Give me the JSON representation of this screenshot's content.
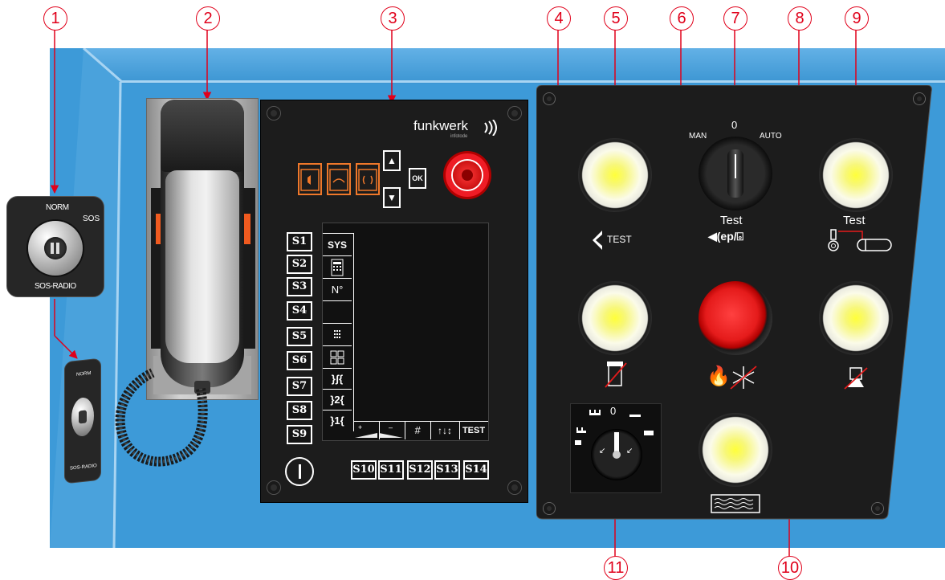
{
  "callouts": [
    "1",
    "2",
    "3",
    "4",
    "5",
    "6",
    "7",
    "8",
    "9",
    "10",
    "11"
  ],
  "sos_switch": {
    "norm": "NORM",
    "sos": "SOS",
    "radio": "SOS-RADIO"
  },
  "radio_panel": {
    "brand": "funkwerk",
    "brand_sub": "infotode",
    "ok_label": "OK",
    "s_keys_left": [
      "S1",
      "S2",
      "S3",
      "S4",
      "S5",
      "S6",
      "S7",
      "S8",
      "S9"
    ],
    "s_keys_bottom": [
      "S10",
      "S11",
      "S12",
      "S13",
      "S14"
    ],
    "display_items": [
      "SYS",
      "",
      "N°",
      "",
      "",
      "",
      "}ʃ{",
      "}2{",
      "}1{"
    ],
    "display_bottom": [
      "",
      "",
      "#",
      "",
      "TEST"
    ]
  },
  "rotary_switch_7": {
    "man": "MAN",
    "zero": "0",
    "auto": "AUTO",
    "test": "Test"
  },
  "button_5": {
    "test": "TEST"
  },
  "button_9": {
    "test": "Test"
  },
  "rotary_switch_11": {
    "zero": "0"
  },
  "colors": {
    "desk_blue": "#3d9ad8",
    "panel_black": "#1c1c1c",
    "callout_red": "#e0001a",
    "lamp_yellow": "#ffff3a",
    "alarm_red": "#e51b1b"
  }
}
